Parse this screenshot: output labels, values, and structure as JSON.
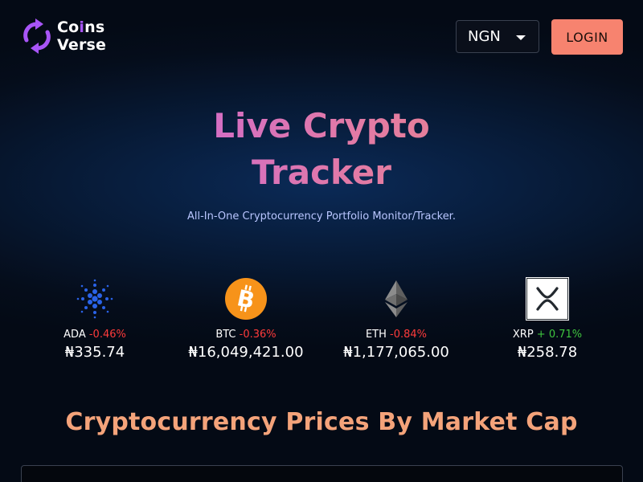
{
  "brand": {
    "line1_prefix": "Co",
    "line1_accent": "i",
    "line1_suffix": "ns",
    "line2": "Verse"
  },
  "currency": {
    "selected": "NGN"
  },
  "login": {
    "label": "LOGIN"
  },
  "hero": {
    "title_line1": "Live Crypto",
    "title_line2": "Tracker",
    "subtitle": "All-In-One Cryptocurrency Portfolio  Monitor/Tracker."
  },
  "coins": [
    {
      "symbol": "ADA",
      "change": "-0.46%",
      "price": "₦335.74",
      "icon": "cardano-icon"
    },
    {
      "symbol": "BTC",
      "change": "-0.36%",
      "price": "₦16,049,421.00",
      "icon": "bitcoin-icon"
    },
    {
      "symbol": "ETH",
      "change": "-0.84%",
      "price": "₦1,177,065.00",
      "icon": "ethereum-icon"
    },
    {
      "symbol": "XRP",
      "change": "+ 0.71%",
      "price": "₦258.78",
      "icon": "xrp-icon"
    }
  ],
  "section": {
    "title": "Cryptocurrency Prices By Market Cap"
  },
  "colors": {
    "accent_purple": "#a855f7",
    "login_bg": "#f7836f",
    "negative": "#ff3b3b",
    "positive": "#3ec43e",
    "section_title": "#f4a37a"
  }
}
